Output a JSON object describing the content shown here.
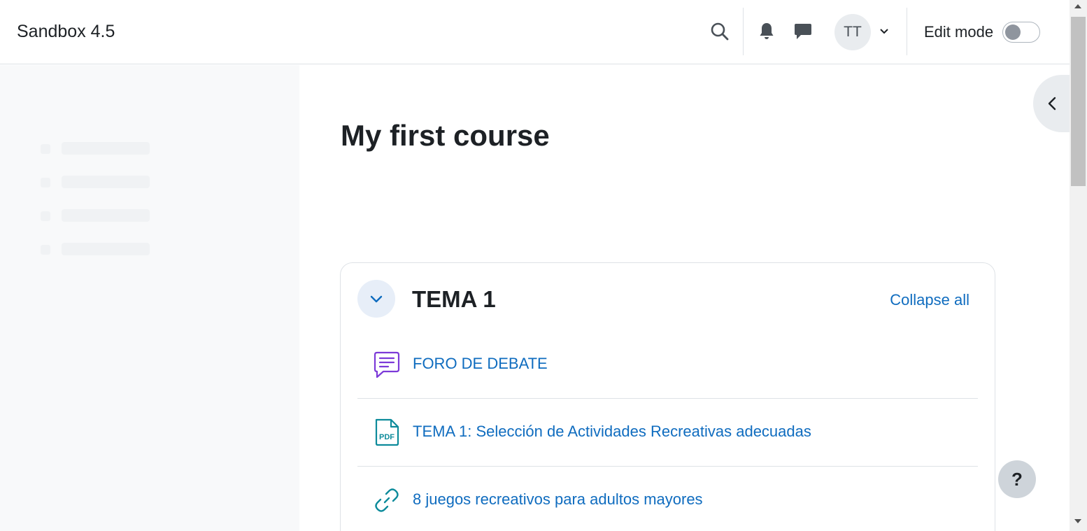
{
  "header": {
    "site_name": "Sandbox 4.5",
    "avatar_initials": "TT",
    "edit_mode_label": "Edit mode",
    "edit_mode_on": false
  },
  "course": {
    "title": "My first course"
  },
  "section": {
    "title": "TEMA 1",
    "collapse_all_label": "Collapse all",
    "activities": [
      {
        "name": "FORO DE DEBATE",
        "icon": "forum-icon",
        "color": "#7c3ad8"
      },
      {
        "name": "TEMA 1: Selección de Actividades Recreativas adecuadas",
        "icon": "pdf-file-icon",
        "color": "#0d8b9b",
        "icon_text": "PDF"
      },
      {
        "name": "8 juegos recreativos para adultos mayores",
        "icon": "link-icon",
        "color": "#0d8b9b"
      }
    ]
  },
  "help": {
    "label": "?"
  },
  "colors": {
    "link": "#0f6cbf",
    "forum_icon": "#7c3ad8",
    "resource_icon": "#0d8b9b"
  }
}
